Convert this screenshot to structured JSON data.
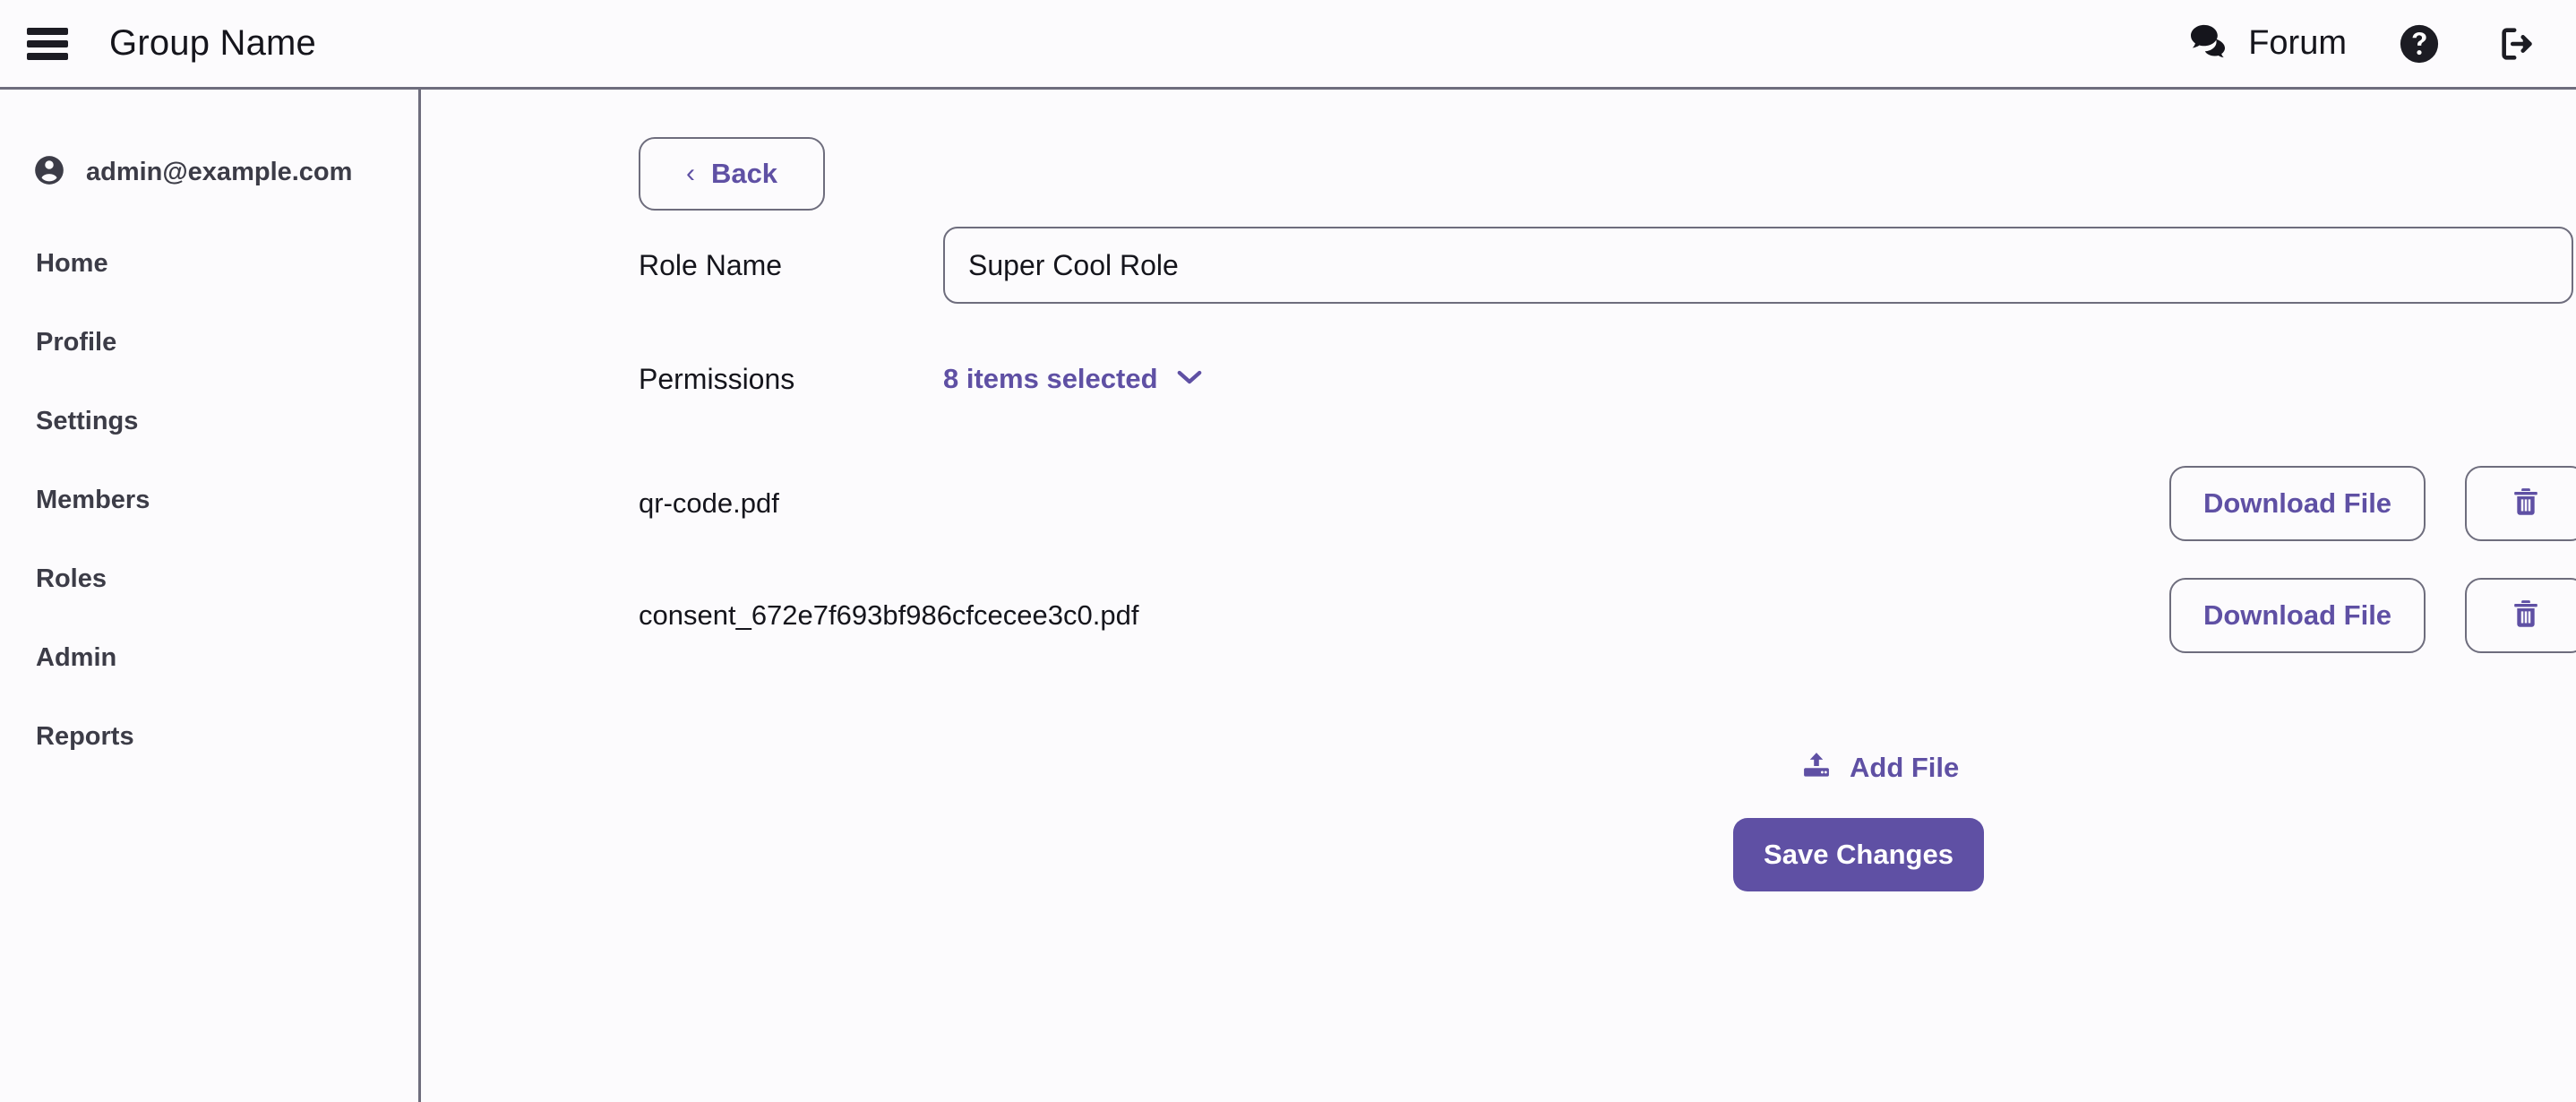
{
  "theme": {
    "accent": "#5f50a4",
    "background": "#fcfbfd",
    "border": "#6e6d7d",
    "text": "#15151c",
    "muted_text": "#3c3c47"
  },
  "header": {
    "menu_icon": "hamburger-menu-icon",
    "title": "Group Name",
    "forum_label": "Forum",
    "forum_icon": "chat-bubbles-icon",
    "help_icon": "help-circle-icon",
    "logout_icon": "logout-icon"
  },
  "sidebar": {
    "user_icon": "account-circle-icon",
    "user_email": "admin@example.com",
    "items": [
      {
        "label": "Home"
      },
      {
        "label": "Profile"
      },
      {
        "label": "Settings"
      },
      {
        "label": "Members"
      },
      {
        "label": "Roles"
      },
      {
        "label": "Admin"
      },
      {
        "label": "Reports"
      }
    ]
  },
  "main": {
    "back": {
      "label": "Back",
      "icon": "chevron-left-icon"
    },
    "role_name": {
      "label": "Role Name",
      "value": "Super Cool Role",
      "placeholder": "Role Name"
    },
    "permissions": {
      "label": "Permissions",
      "selected_text": "8 items selected",
      "chevron_icon": "chevron-down-icon"
    },
    "files": [
      {
        "name": "qr-code.pdf",
        "download_label": "Download File",
        "delete_icon": "trash-icon"
      },
      {
        "name": "consent_672e7f693bf986cfcecee3c0.pdf",
        "download_label": "Download File",
        "delete_icon": "trash-icon"
      }
    ],
    "add_file": {
      "label": "Add File",
      "icon": "upload-icon"
    },
    "save": {
      "label": "Save Changes"
    }
  }
}
